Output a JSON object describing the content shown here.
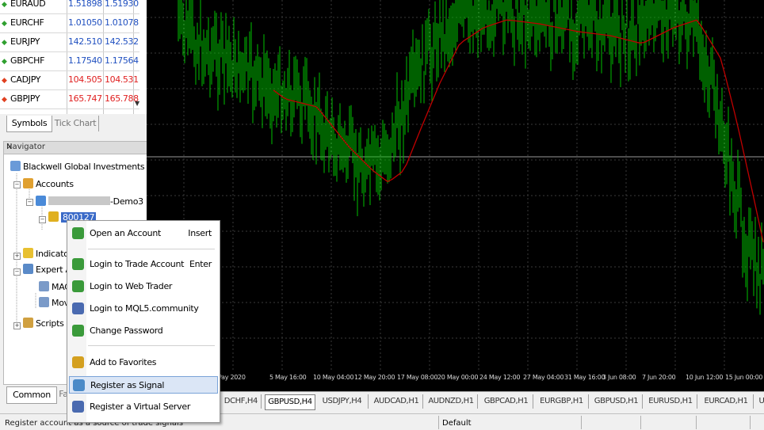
{
  "market_watch": {
    "rows": [
      {
        "symbol": "EURAUD",
        "dir": "up",
        "bid": "1.51898",
        "ask": "1.51930",
        "color": "#2050c0"
      },
      {
        "symbol": "EURCHF",
        "dir": "up",
        "bid": "1.01050",
        "ask": "1.01078",
        "color": "#2050c0"
      },
      {
        "symbol": "EURJPY",
        "dir": "up",
        "bid": "142.510",
        "ask": "142.532",
        "color": "#2050c0"
      },
      {
        "symbol": "GBPCHF",
        "dir": "up",
        "bid": "1.17540",
        "ask": "1.17564",
        "color": "#2050c0"
      },
      {
        "symbol": "CADJPY",
        "dir": "down",
        "bid": "104.505",
        "ask": "104.531",
        "color": "#e02020"
      },
      {
        "symbol": "GBPJPY",
        "dir": "down",
        "bid": "165.747",
        "ask": "165.788",
        "color": "#e02020"
      }
    ],
    "tabs": [
      "Symbols",
      "Tick Chart"
    ]
  },
  "navigator": {
    "title": "Navigator",
    "close": "×",
    "root": "Blackwell Global Investments Lt",
    "accounts": "Accounts",
    "server_suffix": "-Demo3",
    "account_number": "800127",
    "indicators": "Indicato",
    "experts": "Expert A",
    "expert_items": [
      "MAC",
      "Mov"
    ],
    "scripts": "Scripts",
    "tabs": [
      "Common",
      "Fa"
    ]
  },
  "context_menu": {
    "items": [
      {
        "label": "Open an Account",
        "shortcut": "Insert",
        "icon": "person-add-icon",
        "color": "#3a9a3a"
      },
      {
        "label": "Login to Trade Account",
        "shortcut": "Enter",
        "icon": "login-icon",
        "color": "#3a9a3a"
      },
      {
        "label": "Login to Web Trader",
        "shortcut": "",
        "icon": "globe-person-icon",
        "color": "#3a9a3a"
      },
      {
        "label": "Login to MQL5.community",
        "shortcut": "",
        "icon": "community-icon",
        "color": "#4a6ab0"
      },
      {
        "label": "Change Password",
        "shortcut": "",
        "icon": "key-person-icon",
        "color": "#3a9a3a"
      },
      {
        "label": "Add to Favorites",
        "shortcut": "",
        "icon": "star-icon",
        "color": "#d4a020"
      },
      {
        "label": "Register as Signal",
        "shortcut": "",
        "icon": "signal-icon",
        "color": "#4a8ac8"
      },
      {
        "label": "Register a Virtual Server",
        "shortcut": "",
        "icon": "virtual-server-icon",
        "color": "#4a6ab0"
      }
    ]
  },
  "chart": {
    "background": "#000000",
    "candle_color": "#00c000",
    "ma_color": "#c00000",
    "time_labels": [
      "Pay 2020",
      "5 May 16:00",
      "10 May 04:00",
      "12 May 20:00",
      "17 May 08:00",
      "20 May 00:00",
      "24 May 12:00",
      "27 May 04:00",
      "31 May 16:00",
      "3 Jun 08:00",
      "7 Jun 20:00",
      "10 Jun 12:00",
      "15 Jun 00:00"
    ]
  },
  "chart_tabs": [
    "DCHF,H4",
    "GBPUSD,H4",
    "USDJPY,H4",
    "AUDCAD,H1",
    "AUDNZD,H1",
    "GBPCAD,H1",
    "EURGBP,H1",
    "GBPUSD,H1",
    "EURUSD,H1",
    "EURCAD,H1",
    "U"
  ],
  "status": {
    "text": "Register account as a source of trade signals",
    "profile": "Default"
  }
}
